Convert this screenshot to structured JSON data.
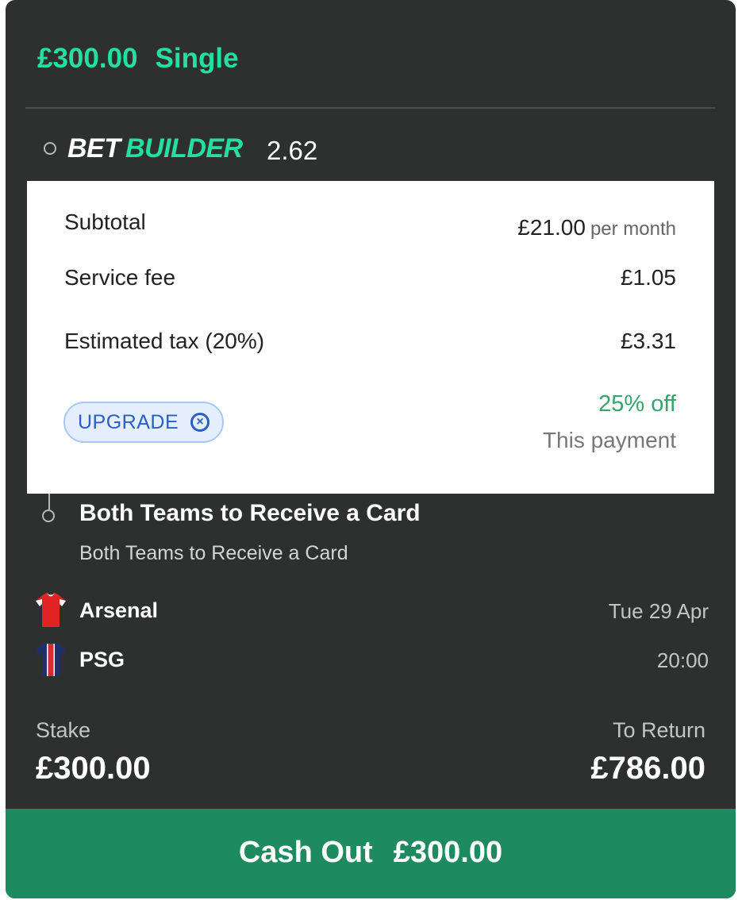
{
  "bet": {
    "stake_header": "£300.00",
    "bet_type": "Single"
  },
  "bet_builder": {
    "word_bet": "BET",
    "word_builder": "BUILDER",
    "odds": "2.62"
  },
  "payment_panel": {
    "subtotal_label": "Subtotal",
    "subtotal_value": "£21.00",
    "subtotal_period": "per month",
    "service_fee_label": "Service fee",
    "service_fee_value": "£1.05",
    "tax_label": "Estimated tax (20%)",
    "tax_value": "£3.31",
    "promo_chip_label": "UPGRADE",
    "discount_text": "25% off",
    "discount_scope": "This payment"
  },
  "selection": {
    "title": "Both Teams to Receive a Card",
    "subtitle": "Both Teams to Receive a Card"
  },
  "match": {
    "home_team": "Arsenal",
    "away_team": "PSG",
    "date": "Tue 29 Apr",
    "time": "20:00"
  },
  "summary": {
    "stake_label": "Stake",
    "stake_value": "£300.00",
    "return_label": "To Return",
    "return_value": "£786.00"
  },
  "cash_out": {
    "label": "Cash Out",
    "amount": "£300.00"
  },
  "colors": {
    "card_background": "#2e302f",
    "accent_green": "#23e0a0",
    "cash_out_button": "#1e8a5f",
    "discount_green": "#34a56b",
    "chip_blue": "#2a5fc7"
  },
  "icons": {
    "leg_marker": "circle-outline-icon",
    "remove_promo": "close-circle-icon",
    "home_kit": "arsenal-kit-icon",
    "away_kit": "psg-kit-icon"
  }
}
